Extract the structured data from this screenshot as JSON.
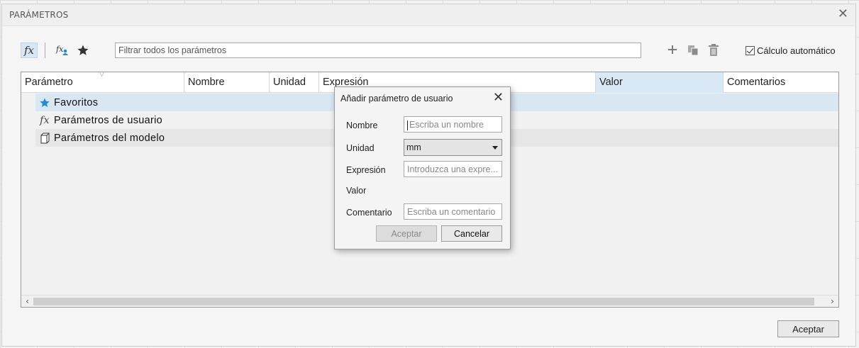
{
  "window": {
    "title": "PARÁMETROS"
  },
  "toolbar": {
    "filter_placeholder": "Filtrar todos los parámetros",
    "auto_calc_label": "Cálculo automático",
    "auto_calc_checked": true
  },
  "table": {
    "columns": [
      "Parámetro",
      "Nombre",
      "Unidad",
      "Expresión",
      "Valor",
      "Comentarios"
    ],
    "rows": [
      {
        "label": "Favoritos",
        "icon": "star-icon"
      },
      {
        "label": "Parámetros de usuario",
        "icon": "fx-icon"
      },
      {
        "label": "Parámetros del modelo",
        "icon": "model-cube-icon"
      }
    ]
  },
  "footer": {
    "ok_label": "Aceptar"
  },
  "dialog": {
    "title": "Añadir parámetro de usuario",
    "name_label": "Nombre",
    "name_placeholder": "Escriba un nombre",
    "unit_label": "Unidad",
    "unit_value": "mm",
    "expression_label": "Expresión",
    "expression_placeholder": "Introduzca una expre...",
    "value_label": "Valor",
    "comment_label": "Comentario",
    "comment_placeholder": "Escriba un comentario",
    "ok_label": "Aceptar",
    "cancel_label": "Cancelar"
  },
  "colors": {
    "accent_star": "#1a8fd6",
    "selected_row": "#d9e7f3"
  }
}
